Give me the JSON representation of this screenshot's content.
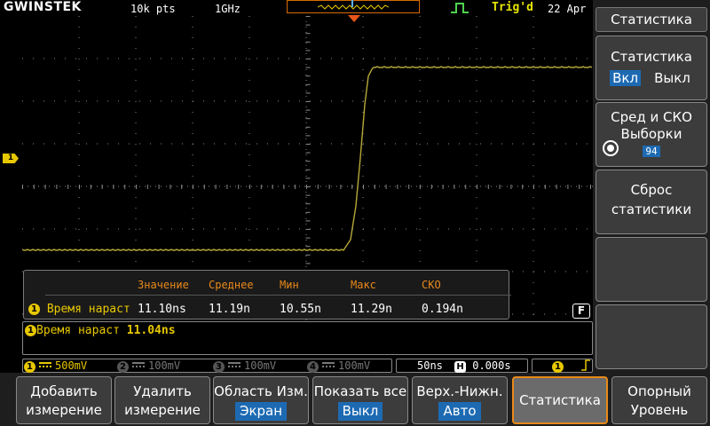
{
  "topbar": {
    "brand": "GWINSTEK",
    "record_length": "10k pts",
    "sample_rate": "1GHz",
    "trigger_status": "Trig'd",
    "date": "22 Apr"
  },
  "overlay": {
    "channel_marker": "1",
    "headers": [
      "Значение",
      "Среднее",
      "Мин",
      "Макс",
      "СКО"
    ],
    "row": {
      "badge": "1",
      "name": "Время нараст",
      "value": "11.10ns",
      "mean": "11.19n",
      "min": "10.55n",
      "max": "11.29n",
      "stddev": "0.194n"
    },
    "f_icon": "F"
  },
  "measurement": {
    "badge": "1",
    "name": "Время нараст",
    "value": "11.04ns"
  },
  "channels": [
    {
      "num": "1",
      "scale": "500mV",
      "active": true
    },
    {
      "num": "2",
      "scale": "100mV",
      "active": false
    },
    {
      "num": "3",
      "scale": "100mV",
      "active": false
    },
    {
      "num": "4",
      "scale": "100mV",
      "active": false
    }
  ],
  "timebase": {
    "scale": "50ns",
    "h_icon": "H",
    "position": "0.000s",
    "trigger_source": "1"
  },
  "side_menu": {
    "title": "Статистика",
    "statistics": {
      "label": "Статистика",
      "on": "Вкл",
      "off": "Выкл",
      "selected": "on"
    },
    "mean_std": {
      "line1": "Сред и СКО",
      "line2": "Выборки",
      "samples": "94"
    },
    "reset": {
      "line1": "Сброс",
      "line2": "статистики"
    }
  },
  "bottom_menu": [
    {
      "id": "add",
      "line1": "Добавить",
      "line2": "измерение"
    },
    {
      "id": "remove",
      "line1": "Удалить",
      "line2": "измерение"
    },
    {
      "id": "gating",
      "line1": "Область Изм.",
      "value": "Экран"
    },
    {
      "id": "display_all",
      "line1": "Показать все",
      "value": "Выкл"
    },
    {
      "id": "high_low",
      "line1": "Верх.-Нижн.",
      "value": "Авто"
    },
    {
      "id": "statistics",
      "line1": "Статистика",
      "active": true
    },
    {
      "id": "reference",
      "line1": "Опорный",
      "line2": "Уровень"
    }
  ],
  "colors": {
    "ch1": "#e8c800",
    "trace": "#b5a838",
    "accent_orange": "#e8891a",
    "selection_blue": "#1d6ab3",
    "grid": "#8a8a8a"
  }
}
